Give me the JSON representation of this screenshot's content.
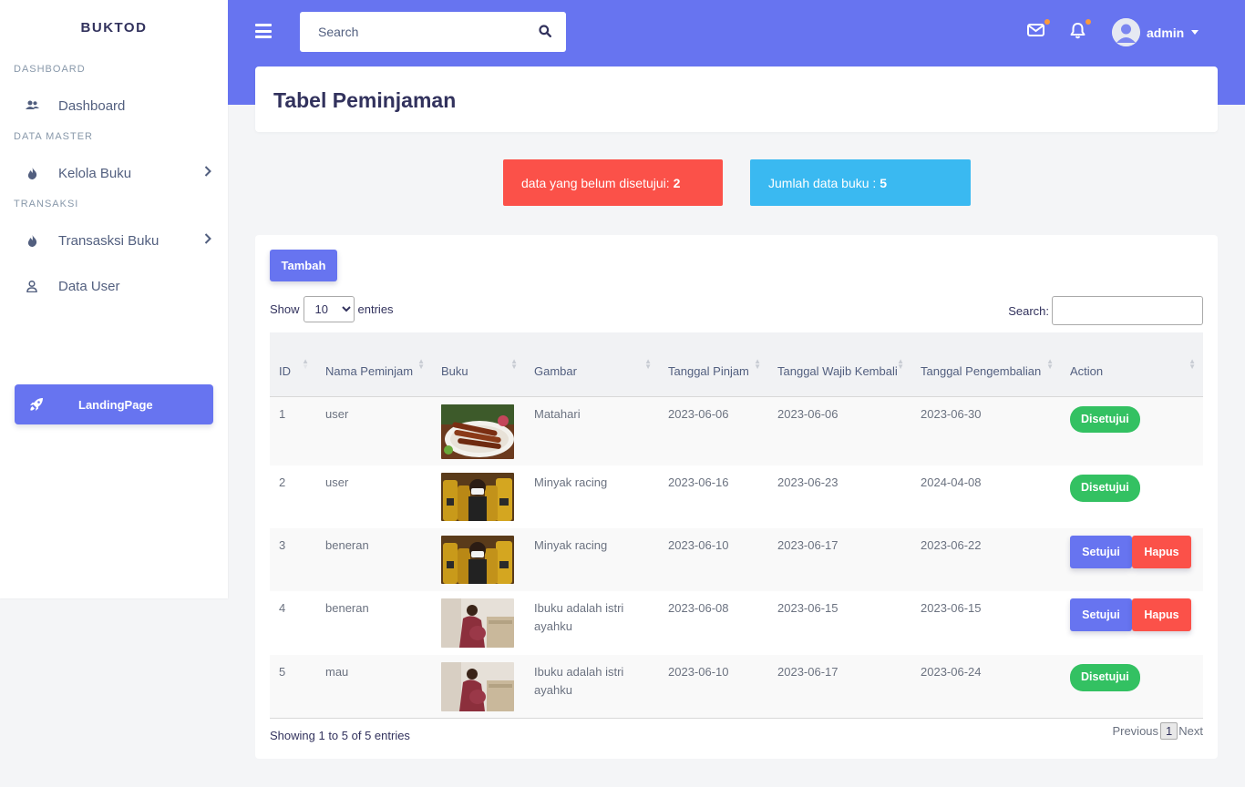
{
  "sidebar": {
    "brand": "BUKTOD",
    "sections": [
      {
        "heading": "DASHBOARD"
      },
      {
        "heading": "DATA MASTER"
      },
      {
        "heading": "TRANSAKSI"
      }
    ],
    "items": {
      "dashboard": "Dashboard",
      "kelola_buku": "Kelola Buku",
      "transaksi_buku": "Transasksi Buku",
      "data_user": "Data User"
    },
    "landing_button": "LandingPage"
  },
  "topbar": {
    "search_placeholder": "Search",
    "user_name": "admin",
    "accent": "#6774f0"
  },
  "page": {
    "title": "Tabel Peminjaman"
  },
  "alerts": {
    "pending_label": "data yang belum disetujui:",
    "pending_count": "2",
    "books_label": "Jumlah data buku :",
    "books_count": "5"
  },
  "table": {
    "add_button": "Tambah",
    "show_label": "Show",
    "entries_label": "entries",
    "page_length": "10",
    "search_label": "Search:",
    "columns": [
      "ID",
      "Nama Peminjam",
      "Buku",
      "Gambar",
      "Tanggal Pinjam",
      "Tanggal Wajib Kembali",
      "Tanggal Pengembalian",
      "Action"
    ],
    "rows": [
      {
        "id": "1",
        "nama": "user",
        "buku_image": "sate-photo",
        "gambar": "Matahari",
        "pinjam": "2023-06-06",
        "wajib": "2023-06-06",
        "kembali": "2023-06-30",
        "status": "Disetujui"
      },
      {
        "id": "2",
        "nama": "user",
        "buku_image": "minyak-photo",
        "gambar": "Minyak racing",
        "pinjam": "2023-06-16",
        "wajib": "2023-06-23",
        "kembali": "2024-04-08",
        "status": "Disetujui"
      },
      {
        "id": "3",
        "nama": "beneran",
        "buku_image": "minyak-photo",
        "gambar": "Minyak racing",
        "pinjam": "2023-06-10",
        "wajib": "2023-06-17",
        "kembali": "2023-06-22",
        "approve_label": "Setujui",
        "delete_label": "Hapus"
      },
      {
        "id": "4",
        "nama": "beneran",
        "buku_image": "ibu-photo",
        "gambar": "Ibuku adalah istri ayahku",
        "pinjam": "2023-06-08",
        "wajib": "2023-06-15",
        "kembali": "2023-06-15",
        "approve_label": "Setujui",
        "delete_label": "Hapus"
      },
      {
        "id": "5",
        "nama": "mau",
        "buku_image": "ibu-photo",
        "gambar": "Ibuku adalah istri ayahku",
        "pinjam": "2023-06-10",
        "wajib": "2023-06-17",
        "kembali": "2023-06-24",
        "status": "Disetujui"
      }
    ],
    "info": "Showing 1 to 5 of 5 entries",
    "previous": "Previous",
    "current_page": "1",
    "next": "Next"
  },
  "colors": {
    "primary": "#6774f0",
    "danger": "#fb5149",
    "info": "#3ab9f1",
    "success": "#33c162"
  }
}
